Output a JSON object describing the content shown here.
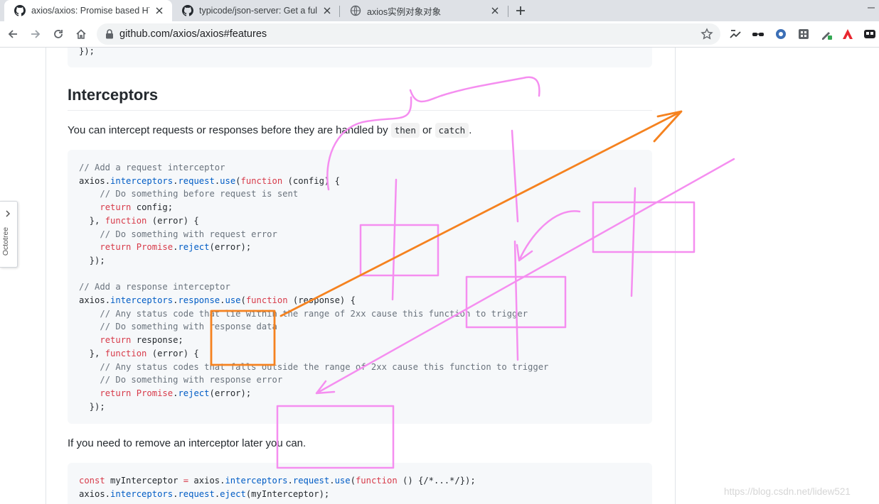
{
  "browser": {
    "tabs": [
      {
        "title": "axios/axios: Promise based HT",
        "active": true
      },
      {
        "title": "typicode/json-server: Get a ful",
        "active": false
      },
      {
        "title": "axios实例对象对象",
        "active": false
      }
    ],
    "url": "github.com/axios/axios#features"
  },
  "sidebar": {
    "octotree_label": "Octotree"
  },
  "content": {
    "prev_code_tail": "});",
    "heading": "Interceptors",
    "intro": {
      "before": "You can intercept requests or responses before they are handled by ",
      "code1": "then",
      "mid": " or ",
      "code2": "catch",
      "after": "."
    },
    "code": {
      "l1": "// Add a request interceptor",
      "l2_obj": "axios",
      "l2_p1": "interceptors",
      "l2_p2": "request",
      "l2_m": "use",
      "l2_kw": "function",
      "l2_rest": " (config) {",
      "l3": "// Do something before request is sent",
      "l4_kw": "return",
      "l4_rest": " config;",
      "l5_a": "  }, ",
      "l5_kw": "function",
      "l5_rest": " (error) {",
      "l6": "// Do something with request error",
      "l7_kw": "return",
      "l7_obj": "Promise",
      "l7_m": "reject",
      "l7_rest": "(error);",
      "l8": "  });",
      "l10": "// Add a response interceptor",
      "l11_obj": "axios",
      "l11_p1": "interceptors",
      "l11_p2": "response",
      "l11_m": "use",
      "l11_kw": "function",
      "l11_rest": " (response) {",
      "l12": "// Any status code that lie within the range of 2xx cause this function to trigger",
      "l13": "// Do something with response data",
      "l14_kw": "return",
      "l14_rest": " response;",
      "l15_a": "  }, ",
      "l15_kw": "function",
      "l15_rest": " (error) {",
      "l16": "// Any status codes that falls outside the range of 2xx cause this function to trigger",
      "l17": "// Do something with response error",
      "l18_kw": "return",
      "l18_obj": "Promise",
      "l18_m": "reject",
      "l18_rest": "(error);",
      "l19": "  });"
    },
    "remove_text": "If you need to remove an interceptor later you can.",
    "code2": {
      "l1_kw": "const",
      "l1_var": " myInterceptor ",
      "l1_eq": "=",
      "l1_obj": " axios.",
      "l1_p1": "interceptors",
      "l1_p2": "request",
      "l1_m": "use",
      "l1_kw2": "function",
      "l1_rest": " () {/*...*/});",
      "l2_obj": "axios.",
      "l2_p1": "interceptors",
      "l2_p2": "request",
      "l2_m": "eject",
      "l2_rest": "(myInterceptor);"
    }
  },
  "watermark": "https://blog.csdn.net/lidew521",
  "colors": {
    "annotation_pink": "#f58ef0",
    "annotation_orange": "#f5821f"
  }
}
